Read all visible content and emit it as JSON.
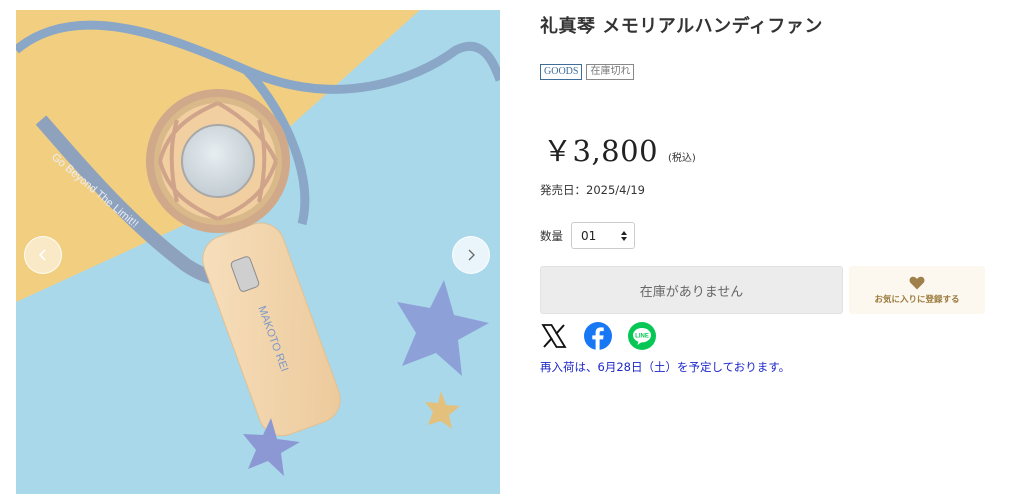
{
  "product": {
    "title": "礼真琴 メモリアルハンディファン",
    "tags": [
      "GOODS",
      "在庫切れ"
    ],
    "price": "￥3,800",
    "tax_note": "(税込)",
    "release_date": "発売日：2025/4/19",
    "quantity": {
      "label": "数量",
      "value": "01"
    },
    "stock_button": "在庫がありません",
    "favorite_button": "お気に入りに登録する",
    "restock_notice": "再入荷は、6月28日（土）を予定しております。"
  },
  "gallery": {
    "strap_text": "Go Beyond The Limit!!",
    "handle_text": "MAKOTO REI",
    "prev_icon": "chevron-left-icon",
    "next_icon": "chevron-right-icon"
  },
  "share": [
    "x-icon",
    "facebook-icon",
    "line-icon"
  ],
  "colors": {
    "background_blue": "#a9d8ea",
    "background_yellow": "#f2cf80",
    "tag_blue": "#3d6d9b",
    "restock_blue": "#1d28c9",
    "favorite_gold": "#9b7a3c",
    "facebook": "#1877f2",
    "line": "#06c755"
  }
}
